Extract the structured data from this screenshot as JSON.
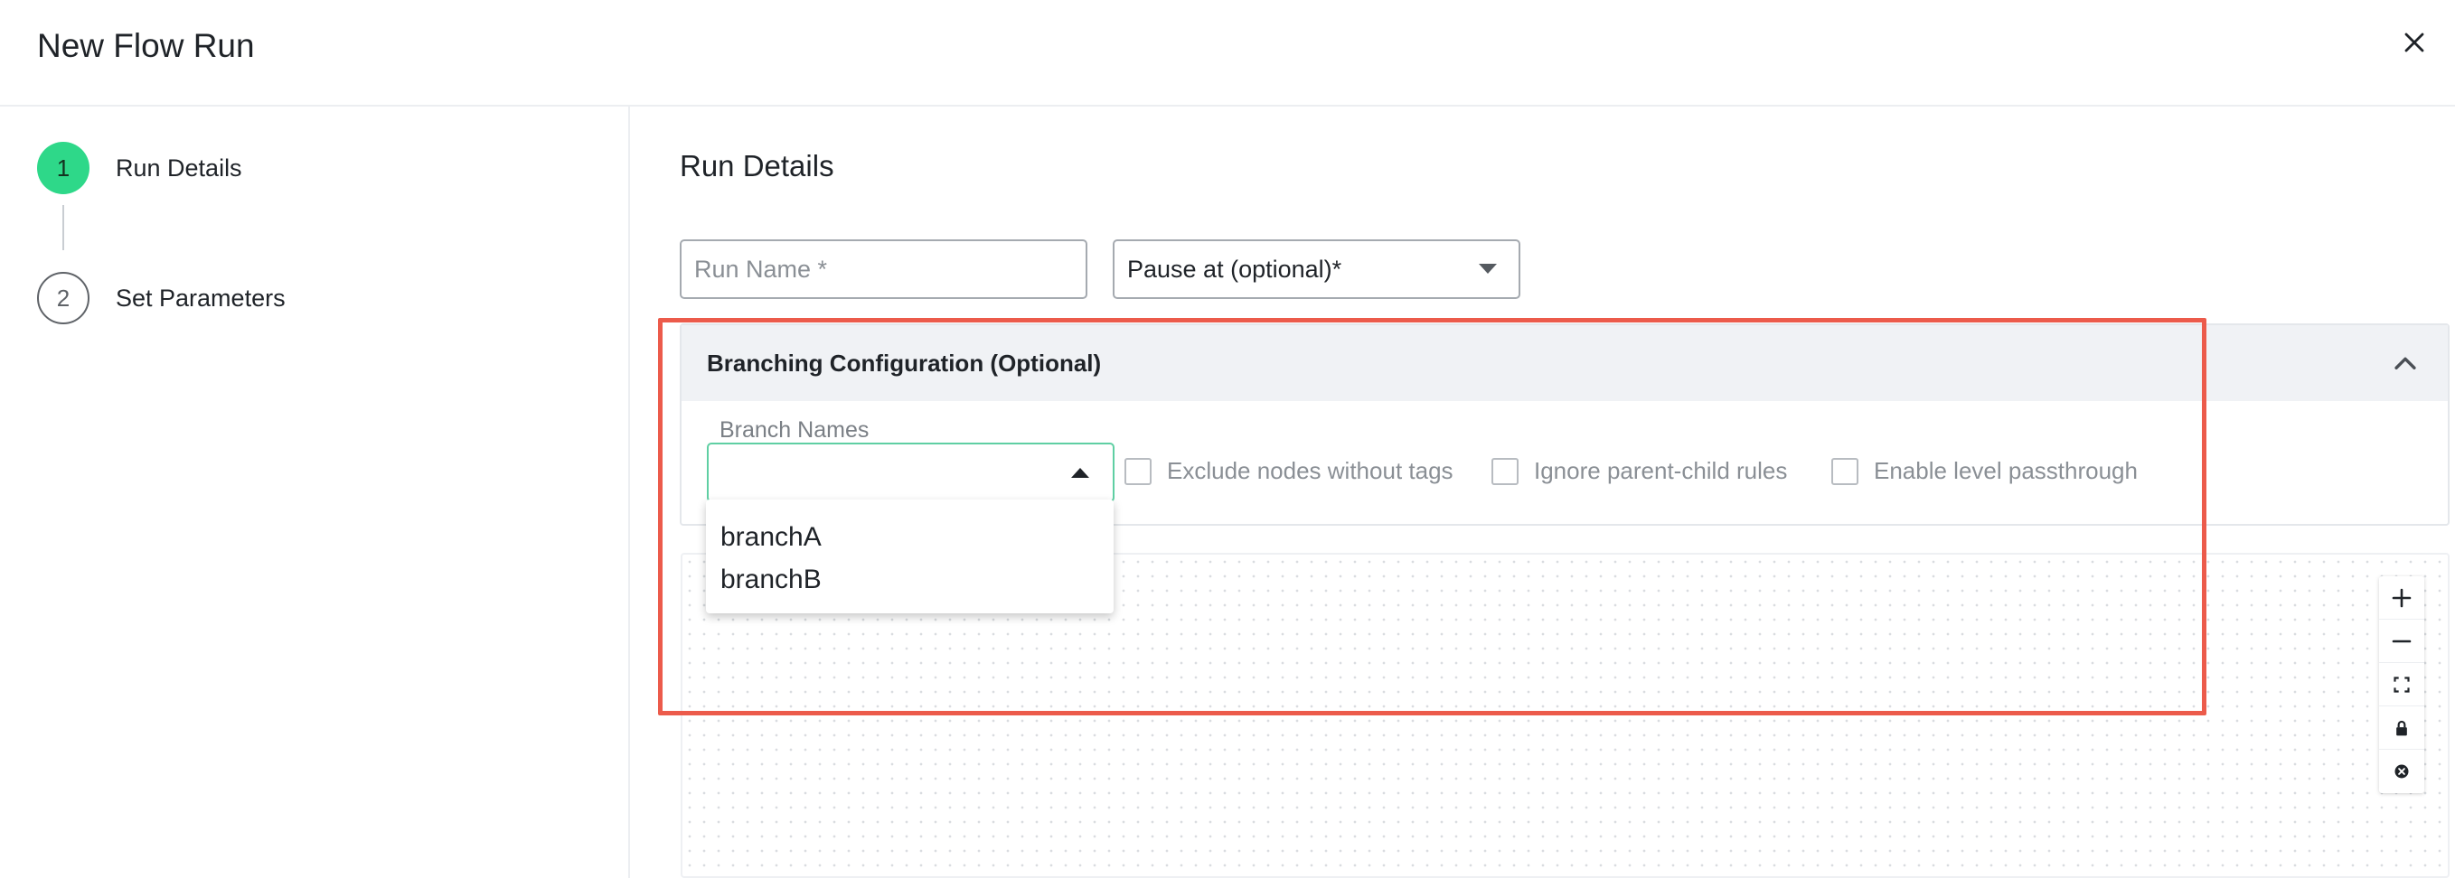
{
  "dialog": {
    "title": "New Flow Run"
  },
  "steps": [
    {
      "number": "1",
      "label": "Run Details"
    },
    {
      "number": "2",
      "label": "Set Parameters"
    }
  ],
  "main": {
    "section_title": "Run Details",
    "run_name_placeholder": "Run Name *",
    "pause_at_value": "Pause at (optional)*"
  },
  "branching": {
    "header": "Branching Configuration (Optional)",
    "branch_names_label": "Branch Names",
    "branch_value": "",
    "options": [
      "branchA",
      "branchB"
    ],
    "checkboxes": [
      {
        "label": "Exclude nodes without tags",
        "checked": false
      },
      {
        "label": "Ignore parent-child rules",
        "checked": false
      },
      {
        "label": "Enable level passthrough",
        "checked": false
      }
    ]
  },
  "flow_controls": [
    "zoom-in-icon",
    "zoom-out-icon",
    "fit-view-icon",
    "lock-icon",
    "close-circle-icon"
  ],
  "colors": {
    "step_active": "#2ed889",
    "focus_border": "#5fcfa3",
    "highlight": "#ec5b4b"
  }
}
